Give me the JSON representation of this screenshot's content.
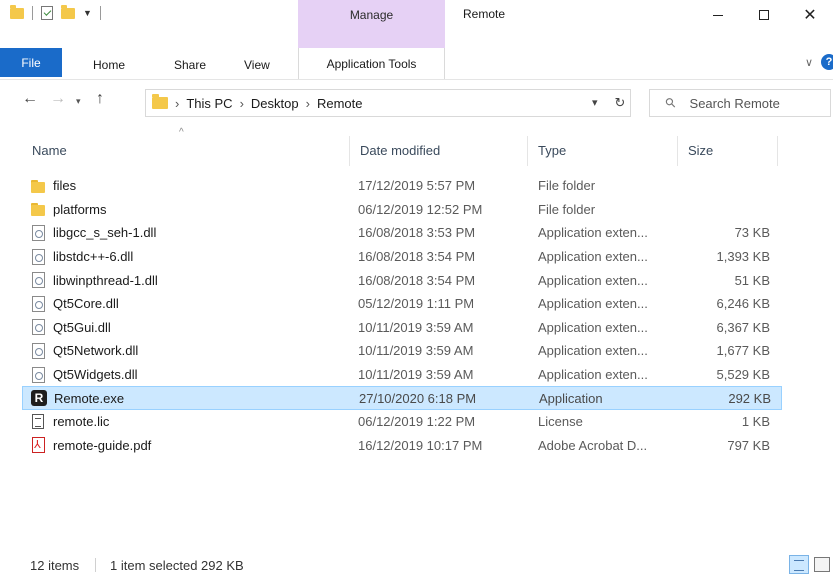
{
  "window": {
    "title": "Remote",
    "contextual_tab_group": "Manage",
    "minimize_glyph": "—",
    "maximize_glyph": "☐",
    "close_glyph": "✕"
  },
  "ribbon": {
    "tabs": [
      "File",
      "Home",
      "Share",
      "View",
      "Application Tools"
    ],
    "active_contextual": "Application Tools",
    "help_glyph": "?"
  },
  "navigation": {
    "back_glyph": "←",
    "forward_glyph": "→",
    "recent_glyph": "⌄",
    "up_glyph": "↑",
    "breadcrumbs": [
      "This PC",
      "Desktop",
      "Remote"
    ],
    "refresh_glyph": "↻",
    "dropdown_glyph": "⌄"
  },
  "search": {
    "placeholder": "Search Remote"
  },
  "columns": {
    "name": "Name",
    "date": "Date modified",
    "type": "Type",
    "size": "Size",
    "sort_glyph": "^"
  },
  "files": [
    {
      "name": "files",
      "date": "17/12/2019 5:57 PM",
      "type": "File folder",
      "size": "",
      "icon": "folder-icon",
      "selected": false
    },
    {
      "name": "platforms",
      "date": "06/12/2019 12:52 PM",
      "type": "File folder",
      "size": "",
      "icon": "folder-icon",
      "selected": false
    },
    {
      "name": "libgcc_s_seh-1.dll",
      "date": "16/08/2018 3:53 PM",
      "type": "Application exten...",
      "size": "73 KB",
      "icon": "dll-icon",
      "selected": false
    },
    {
      "name": "libstdc++-6.dll",
      "date": "16/08/2018 3:54 PM",
      "type": "Application exten...",
      "size": "1,393 KB",
      "icon": "dll-icon",
      "selected": false
    },
    {
      "name": "libwinpthread-1.dll",
      "date": "16/08/2018 3:54 PM",
      "type": "Application exten...",
      "size": "51 KB",
      "icon": "dll-icon",
      "selected": false
    },
    {
      "name": "Qt5Core.dll",
      "date": "05/12/2019 1:11 PM",
      "type": "Application exten...",
      "size": "6,246 KB",
      "icon": "dll-icon",
      "selected": false
    },
    {
      "name": "Qt5Gui.dll",
      "date": "10/11/2019 3:59 AM",
      "type": "Application exten...",
      "size": "6,367 KB",
      "icon": "dll-icon",
      "selected": false
    },
    {
      "name": "Qt5Network.dll",
      "date": "10/11/2019 3:59 AM",
      "type": "Application exten...",
      "size": "1,677 KB",
      "icon": "dll-icon",
      "selected": false
    },
    {
      "name": "Qt5Widgets.dll",
      "date": "10/11/2019 3:59 AM",
      "type": "Application exten...",
      "size": "5,529 KB",
      "icon": "dll-icon",
      "selected": false
    },
    {
      "name": "Remote.exe",
      "date": "27/10/2020 6:18 PM",
      "type": "Application",
      "size": "292 KB",
      "icon": "app-icon",
      "selected": true
    },
    {
      "name": "remote.lic",
      "date": "06/12/2019 1:22 PM",
      "type": "License",
      "size": "1 KB",
      "icon": "license-file-icon",
      "selected": false
    },
    {
      "name": "remote-guide.pdf",
      "date": "16/12/2019 10:17 PM",
      "type": "Adobe Acrobat D...",
      "size": "797 KB",
      "icon": "pdf-icon",
      "selected": false
    }
  ],
  "app_icon_letter": "R",
  "status": {
    "item_count": "12 items",
    "selection": "1 item selected  292 KB"
  },
  "colors": {
    "file_tab": "#1a6bc9",
    "contextual_tab": "#e6d1f5",
    "selection_bg": "#cce8ff",
    "folder": "#f4c84a"
  }
}
